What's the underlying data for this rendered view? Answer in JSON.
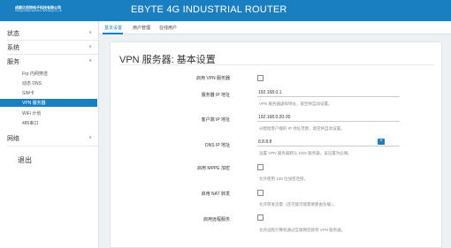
{
  "header": {
    "company_cn": "成都亿佰特电子科技有限公司",
    "company_en": "Chengdu Ebyte Electronic Technology Co.,Ltd",
    "title": "EBYTE 4G INDUSTRIAL ROUTER",
    "bg_color": "#1a7fc1"
  },
  "sidebar": {
    "groups": [
      {
        "label": "状态",
        "icon": "chevron-down-icon"
      },
      {
        "label": "系统",
        "icon": "chevron-down-icon"
      },
      {
        "label": "服务",
        "icon": "chevron-up-icon"
      },
      {
        "label": "网络",
        "icon": "chevron-down-icon"
      }
    ],
    "service_items": [
      {
        "label": "Frp 内网穿透"
      },
      {
        "label": "动态 DNS"
      },
      {
        "label": "SIM卡"
      },
      {
        "label": "VPN 服务器",
        "active": true
      },
      {
        "label": "WiFi 计划"
      },
      {
        "label": "485串口"
      }
    ],
    "logout": "退出",
    "active_color": "#1a7fc1"
  },
  "tabs": [
    {
      "label": "基本设置",
      "active": true
    },
    {
      "label": "用户管理"
    },
    {
      "label": "在线用户"
    }
  ],
  "panel": {
    "title": "VPN 服务器: 基本设置",
    "fields": {
      "enable_vpn": {
        "label": "启用 VPN 服务器",
        "checked": false
      },
      "server_ip": {
        "label": "服务器 IP 地址",
        "value": "192.168.0.1",
        "hint": "VPN 服务器虚拟地址，留空将自动设置。"
      },
      "client_ip": {
        "label": "客户端 IP 地址",
        "value": "192.168.0.20-30",
        "hint": "分配给客户端的 IP 地址范围，留空将自动设置。"
      },
      "dns_ip": {
        "label": "DNS IP 地址",
        "value": "8.8.8.8",
        "hint": "设置 VPN 服务器默认 DNS 服务器，该设置为必填。",
        "add_label": "+"
      },
      "enable_mppe": {
        "label": "启用 MPPE 加密",
        "checked": false,
        "hint": "允许使用 128 位加密连接。"
      },
      "enable_nat": {
        "label": "启用 NAT 转发",
        "checked": false,
        "hint": "允许转发流量（还可能可能需要路由负载）。"
      },
      "remote_service": {
        "label": "启用远程服务",
        "checked": false,
        "hint": "允许远程计算机通过互联网连接到 VPN 服务器。"
      }
    }
  }
}
